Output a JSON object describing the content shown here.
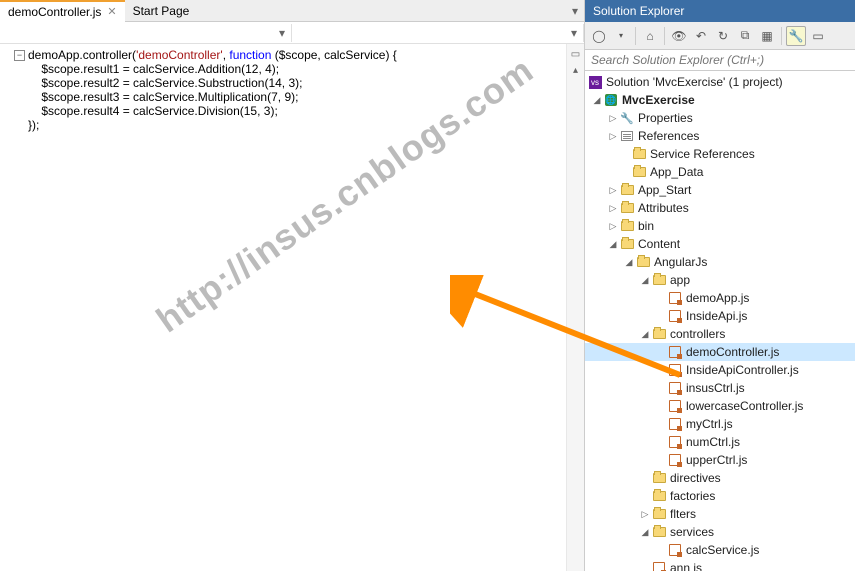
{
  "tabs": {
    "active": "demoController.js",
    "other": "Start Page"
  },
  "code": {
    "line1_pre": "demoApp.controller(",
    "line1_str": "'demoController'",
    "line1_mid": ", ",
    "line1_kw": "function",
    "line1_post": " ($scope, calcService) {",
    "line2": "    $scope.result1 = calcService.Addition(12, 4);",
    "line3": "    $scope.result2 = calcService.Substruction(14, 3);",
    "line4": "    $scope.result3 = calcService.Multiplication(7, 9);",
    "line5": "    $scope.result4 = calcService.Division(15, 3);",
    "line6": "});"
  },
  "watermark": "http://insus.cnblogs.com",
  "explorer": {
    "title": "Solution Explorer",
    "search_placeholder": "Search Solution Explorer (Ctrl+;)",
    "solution": "Solution 'MvcExercise' (1 project)",
    "project": "MvcExercise",
    "nodes": {
      "properties": "Properties",
      "references": "References",
      "service_refs": "Service References",
      "app_data": "App_Data",
      "app_start": "App_Start",
      "attributes": "Attributes",
      "bin": "bin",
      "content": "Content",
      "angularjs": "AngularJs",
      "app": "app",
      "demoapp": "demoApp.js",
      "insideapi": "InsideApi.js",
      "controllers": "controllers",
      "democontroller": "demoController.js",
      "insideapicontroller": "InsideApiController.js",
      "insusctrl": "insusCtrl.js",
      "lowercase": "lowercaseController.js",
      "myctrl": "myCtrl.js",
      "numctrl": "numCtrl.js",
      "upperctrl": "upperCtrl.js",
      "directives": "directives",
      "factories": "factories",
      "filters": "flters",
      "services": "services",
      "calcservice": "calcService.js",
      "appjs": "ann is"
    }
  }
}
